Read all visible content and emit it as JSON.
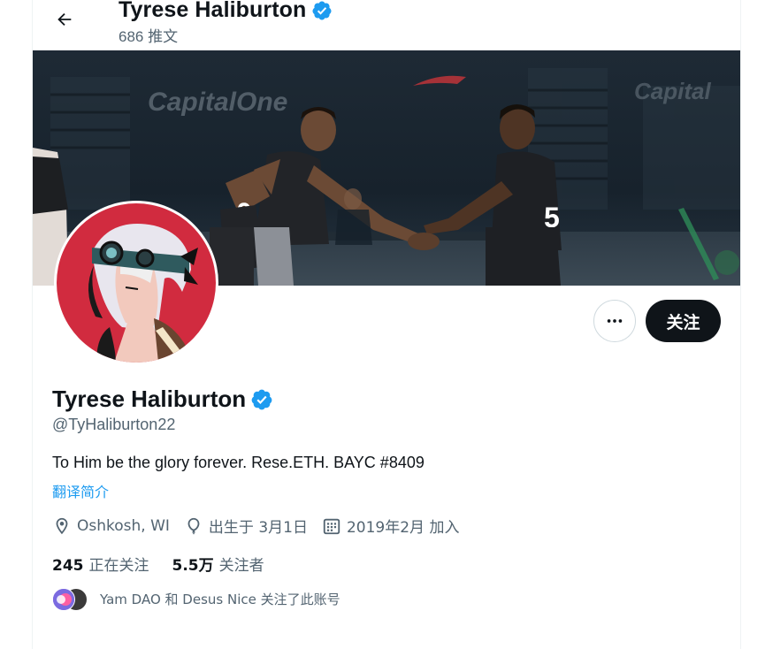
{
  "header": {
    "back_icon": "arrow-left-icon",
    "name": "Tyrese Haliburton",
    "tweet_count": "686 推文"
  },
  "banner": {
    "sponsor_text": "CapitalOne",
    "jersey_left": "0",
    "jersey_right": "5"
  },
  "actions": {
    "more_icon": "ellipsis-icon",
    "follow_label": "关注"
  },
  "profile": {
    "name": "Tyrese Haliburton",
    "verified_icon": "verified-badge-icon",
    "handle": "@TyHaliburton22",
    "bio": "To Him be the glory forever. Rese.ETH. BAYC #8409",
    "translate_label": "翻译简介",
    "location": "Oshkosh, WI",
    "birthday": "出生于 3月1日",
    "joined": "2019年2月 加入"
  },
  "stats": {
    "following_count": "245",
    "following_label": "正在关注",
    "followers_count": "5.5万",
    "followers_label": "关注者"
  },
  "followed_by": {
    "text": "Yam DAO 和 Desus Nice 关注了此账号"
  },
  "colors": {
    "accent": "#1d9bf0",
    "avatar_bg": "#d12b3f",
    "follow_button_bg": "#0f1419"
  }
}
